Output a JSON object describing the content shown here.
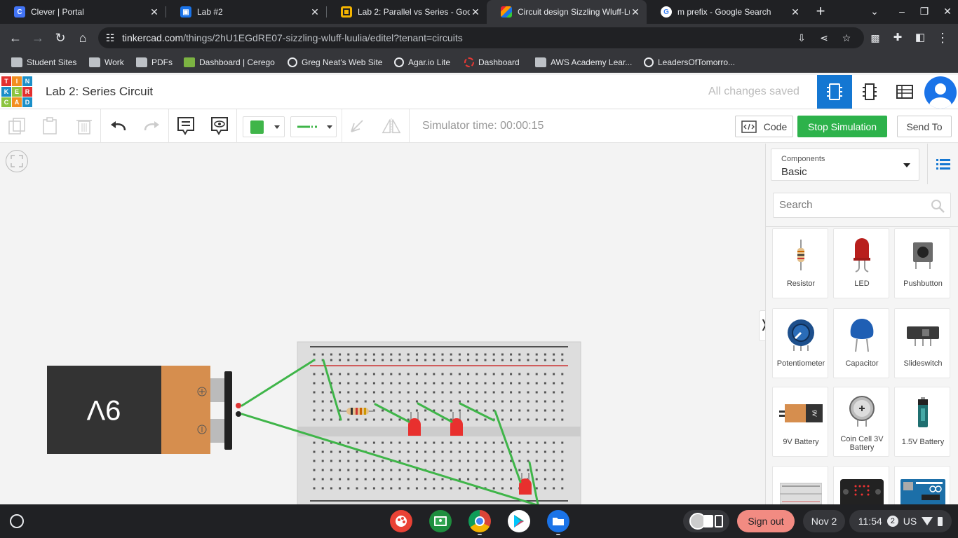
{
  "browser": {
    "tabs": [
      {
        "title": "Clever | Portal",
        "active": false
      },
      {
        "title": "Lab #2",
        "active": false
      },
      {
        "title": "Lab 2: Parallel vs Series - Goog",
        "active": false
      },
      {
        "title": "Circuit design Sizzling Wluff-Lu",
        "active": true
      },
      {
        "title": "m prefix - Google Search",
        "active": false
      }
    ],
    "url_host": "tinkercad.com",
    "url_path": "/things/2hU1EGdRE07-sizzling-wluff-luulia/editel?tenant=circuits",
    "bookmarks": [
      "Student Sites",
      "Work",
      "PDFs",
      "Dashboard | Cerego",
      "Greg Neat's Web Site",
      "Agar.io Lite",
      "Dashboard",
      "AWS Academy Lear...",
      "LeadersOfTomorro..."
    ]
  },
  "tinkercad": {
    "logo_letters": [
      "T",
      "I",
      "N",
      "K",
      "E",
      "R",
      "C",
      "A",
      "D"
    ],
    "design_title": "Lab 2: Series Circuit",
    "save_status": "All changes saved",
    "simulator_time": "Simulator time: 00:00:15",
    "code_label": "Code",
    "stop_label": "Stop Simulation",
    "send_label": "Send To",
    "battery_label": "9V",
    "accent": "#1477d2",
    "sim_color": "#2db24b",
    "wire_color": "#3fb549"
  },
  "panel": {
    "components_label": "Components",
    "components_value": "Basic",
    "search_placeholder": "Search",
    "items": [
      {
        "name": "Resistor"
      },
      {
        "name": "LED"
      },
      {
        "name": "Pushbutton"
      },
      {
        "name": "Potentiometer"
      },
      {
        "name": "Capacitor"
      },
      {
        "name": "Slideswitch"
      },
      {
        "name": "9V Battery"
      },
      {
        "name": "Coin Cell 3V Battery"
      },
      {
        "name": "1.5V Battery"
      },
      {
        "name": "",
        "icon": "breadboard-icon"
      },
      {
        "name": "",
        "icon": "microbit-icon"
      },
      {
        "name": "",
        "icon": "arduino-icon"
      }
    ]
  },
  "shelf": {
    "signout": "Sign out",
    "date": "Nov 2",
    "time": "11:54",
    "notifications": "2",
    "locale": "US"
  }
}
